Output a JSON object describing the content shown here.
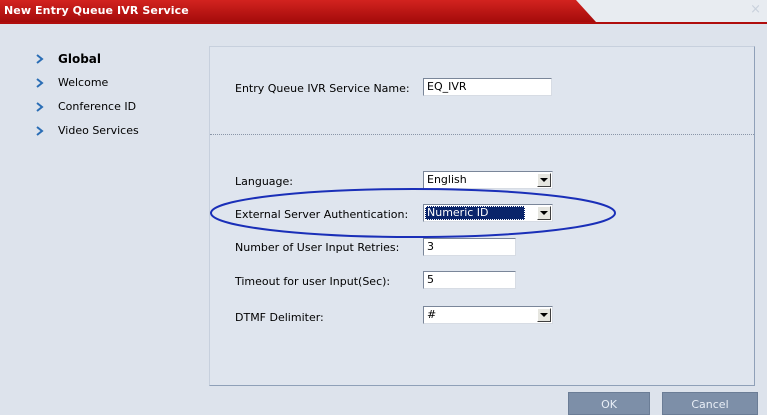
{
  "window": {
    "title": "New Entry Queue IVR Service",
    "close_glyph": "×"
  },
  "nav": {
    "items": [
      {
        "label": "Global",
        "active": true
      },
      {
        "label": "Welcome",
        "active": false
      },
      {
        "label": "Conference ID",
        "active": false
      },
      {
        "label": "Video Services",
        "active": false
      }
    ]
  },
  "form": {
    "service_name": {
      "label": "Entry Queue IVR Service Name:",
      "value": "EQ_IVR"
    },
    "language": {
      "label": "Language:",
      "value": "English"
    },
    "external_auth": {
      "label": "External Server Authentication:",
      "value": "Numeric ID"
    },
    "retries": {
      "label": "Number of User Input Retries:",
      "value": "3"
    },
    "timeout": {
      "label": "Timeout for user Input(Sec):",
      "value": "5"
    },
    "dtmf": {
      "label": "DTMF Delimiter:",
      "value": "#"
    }
  },
  "buttons": {
    "ok": "OK",
    "cancel": "Cancel"
  },
  "colors": {
    "title_red": "#b00d0d",
    "highlight_ellipse": "#1a2fb8",
    "nav_arrow": "#2a6db5",
    "button_bg": "#7d8fa8"
  },
  "icons": {
    "nav_arrow": "chevron-right-icon",
    "dropdown": "chevron-down-icon",
    "close": "close-icon"
  }
}
